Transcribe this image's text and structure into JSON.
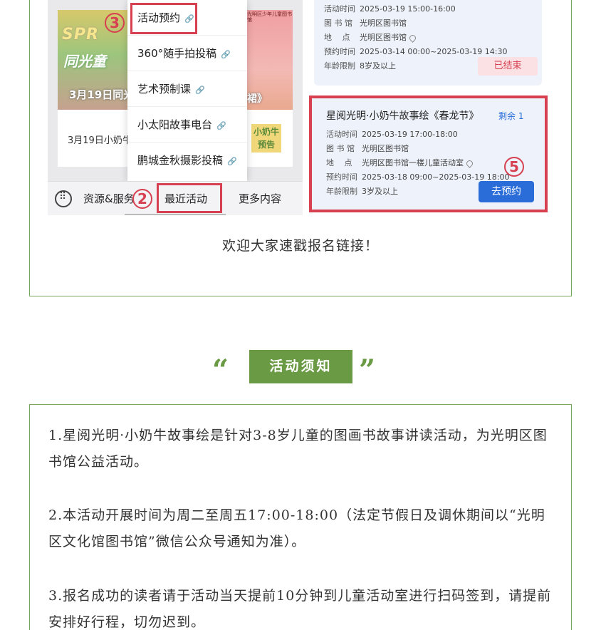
{
  "menu": {
    "items": [
      {
        "label": "活动预约"
      },
      {
        "label": "360°随手拍投稿"
      },
      {
        "label": "艺术预制课"
      },
      {
        "label": "小太阳故事电台"
      },
      {
        "label": "鹏城金秋摄影投稿"
      }
    ]
  },
  "bottom_bar": {
    "resources": "资源&服务",
    "recent": "最近活动",
    "more": "更多内容"
  },
  "step_numbers": {
    "two": "2",
    "three": "3",
    "five": "5"
  },
  "posters": {
    "left_big": "SPR",
    "left_big2": "同光童",
    "left_caption": "3月19日同光",
    "left_card_text": "3月19日小奶牛",
    "right_lib": "光明区少年儿童图书馆",
    "right_caption": "裙》",
    "right_tag": "小奶牛 预告"
  },
  "ended_activity": {
    "time_key": "活动时间",
    "time_val": "2025-03-19 15:00-16:00",
    "lib_key": "图 书 馆",
    "lib_val": "光明区图书馆",
    "loc_key": "地　 点",
    "loc_val": "光明区图书馆",
    "book_key": "预约时间",
    "book_val": "2025-03-14 00:00~2025-03-19 14:30",
    "age_key": "年龄限制",
    "age_val": "8岁及以上",
    "status": "已结束"
  },
  "open_activity": {
    "title": "星阅光明·小奶牛故事绘《春龙节》",
    "remaining": "剩余 1",
    "time_key": "活动时间",
    "time_val": "2025-03-19 17:00-18:00",
    "lib_key": "图 书 馆",
    "lib_val": "光明区图书馆",
    "loc_key": "地　 点",
    "loc_val": "光明区图书馆一楼儿童活动室",
    "book_key": "预约时间",
    "book_val": "2025-03-18 09:00~2025-03-19 18:00",
    "age_key": "年龄限制",
    "age_val": "3岁及以上",
    "button": "去预约"
  },
  "welcome": "欢迎大家速戳报名链接！",
  "section": {
    "open_quote": "“",
    "title": "活动须知",
    "close_quote": "”"
  },
  "notices": [
    "1.星阅光明·小奶牛故事绘是针对3-8岁儿童的图画书故事讲读活动，为光明区图书馆公益活动。",
    "2.本活动开展时间为周二至周五17:00-18:00（法定节假日及调休期间以“光明区文化馆图书馆”微信公众号通知为准）。",
    "3.报名成功的读者请于活动当天提前10分钟到儿童活动室进行扫码签到，请提前安排好行程，切勿迟到。"
  ],
  "colors": {
    "accent_green": "#6a9a44",
    "highlight_red": "#d64050",
    "button_blue": "#2a6dd9"
  }
}
